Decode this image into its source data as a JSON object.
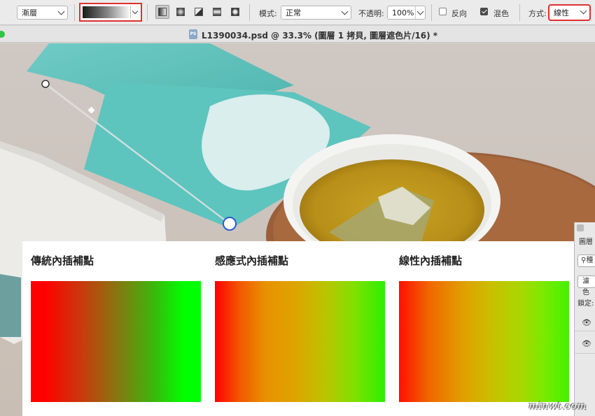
{
  "optionsbar": {
    "tool_preset": "漸層",
    "mode_label": "模式:",
    "mode_value": "正常",
    "opacity_label": "不透明:",
    "opacity_value": "100%",
    "reverse_label": "反向",
    "dither_label": "混色",
    "method_label": "方式:",
    "method_value": "線性",
    "reverse_checked": false,
    "dither_checked": true
  },
  "document": {
    "title": "L1390034.psd @ 33.3% (圖層 1 拷貝, 圖層遮色片/16) *",
    "icon_text": "PS"
  },
  "layers_panel": {
    "title": "圖層",
    "search_text": "種",
    "filter_text": "濾色",
    "lock_label": "鎖定:"
  },
  "comparison": {
    "items": [
      {
        "title": "傳統內插補點"
      },
      {
        "title": "感應式內插補點"
      },
      {
        "title": "線性內插補點"
      }
    ]
  },
  "watermark": "minwt.com",
  "colors": {
    "highlight_red": "#e03030",
    "gradient_start": "#ff0000",
    "gradient_end": "#00ff00",
    "teal_packet": "#5cc3bd"
  }
}
